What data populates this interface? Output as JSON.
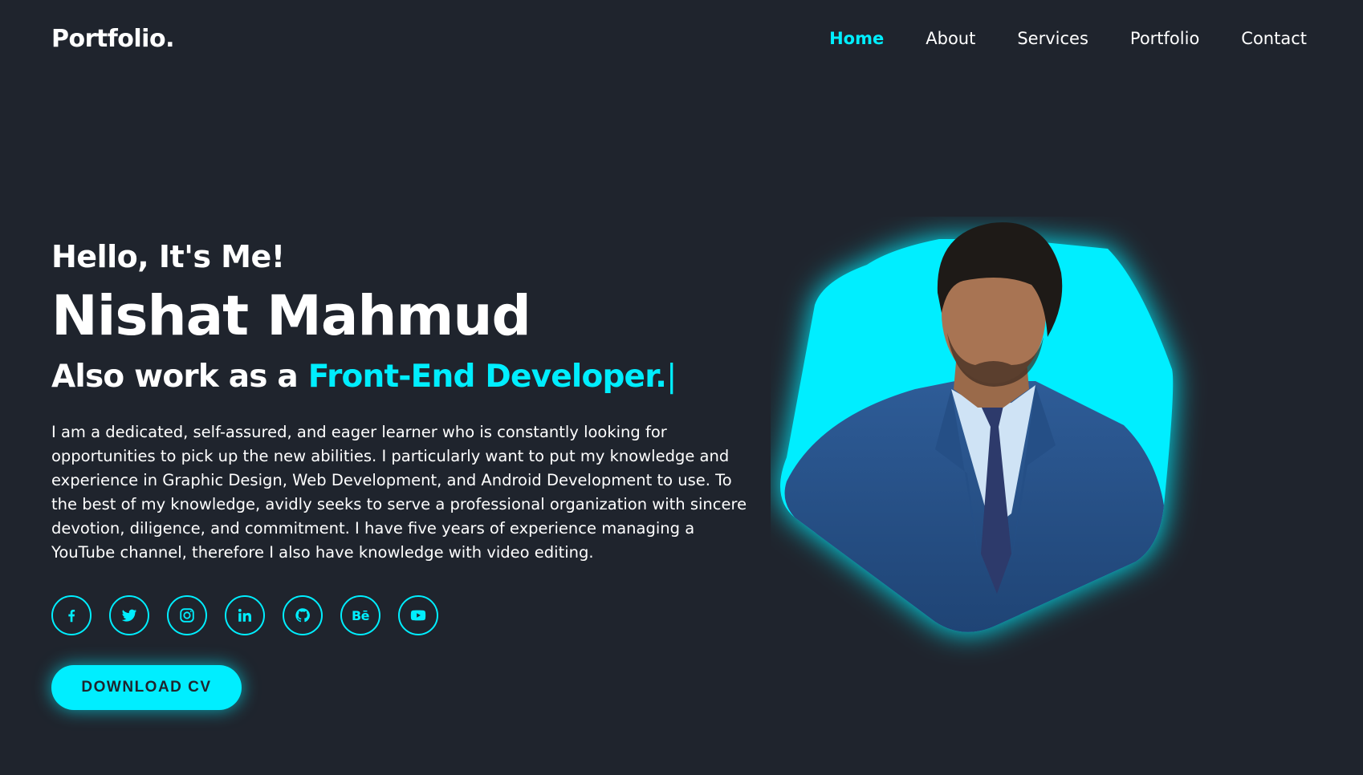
{
  "header": {
    "logo": "Portfolio.",
    "nav": [
      {
        "label": "Home",
        "active": true
      },
      {
        "label": "About",
        "active": false
      },
      {
        "label": "Services",
        "active": false
      },
      {
        "label": "Portfolio",
        "active": false
      },
      {
        "label": "Contact",
        "active": false
      }
    ]
  },
  "hero": {
    "greeting": "Hello, It's Me!",
    "name": "Nishat Mahmud",
    "role_prefix": "Also work as a ",
    "role_highlight": "Front-End Developer.",
    "role_caret": "|",
    "bio": "I am a dedicated, self-assured, and eager learner who is constantly looking for opportunities to pick up the new abilities. I particularly want to put my knowledge and experience in Graphic Design, Web Development, and Android Development to use. To the best of my knowledge, avidly seeks to serve a professional organization with sincere devotion, diligence, and commitment. I have five years of experience managing a YouTube channel, therefore I also have knowledge with video editing.",
    "socials": [
      {
        "icon": "facebook-icon"
      },
      {
        "icon": "twitter-icon"
      },
      {
        "icon": "instagram-icon"
      },
      {
        "icon": "linkedin-icon"
      },
      {
        "icon": "github-icon"
      },
      {
        "icon": "behance-icon",
        "text": "Bē"
      },
      {
        "icon": "youtube-icon"
      }
    ],
    "cta_label": "DOWNLOAD CV",
    "image": {
      "icon": "profile-photo"
    }
  },
  "colors": {
    "background": "#1f242d",
    "accent": "#00eeff",
    "text": "#ffffff"
  }
}
